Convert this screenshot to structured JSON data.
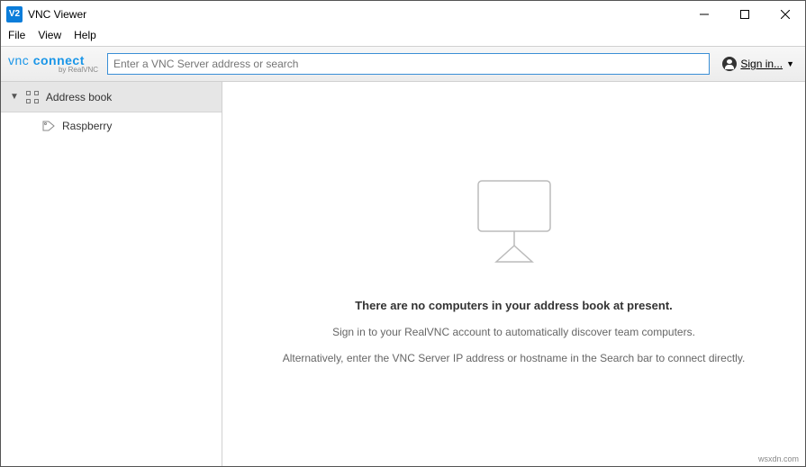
{
  "window": {
    "title": "VNC Viewer",
    "app_icon_text": "V2"
  },
  "menubar": {
    "file": "File",
    "view": "View",
    "help": "Help"
  },
  "toolbar": {
    "logo_top_a": "vnc",
    "logo_top_b": "connect",
    "logo_bottom": "by RealVNC",
    "search_placeholder": "Enter a VNC Server address or search",
    "signin_label": "Sign in..."
  },
  "sidebar": {
    "address_book_label": "Address book",
    "items": [
      {
        "label": "Raspberry"
      }
    ]
  },
  "empty_state": {
    "heading": "There are no computers in your address book at present.",
    "line1": "Sign in to your RealVNC account to automatically discover team computers.",
    "line2": "Alternatively, enter the VNC Server IP address or hostname in the Search bar to connect directly."
  },
  "watermark": "wsxdn.com"
}
